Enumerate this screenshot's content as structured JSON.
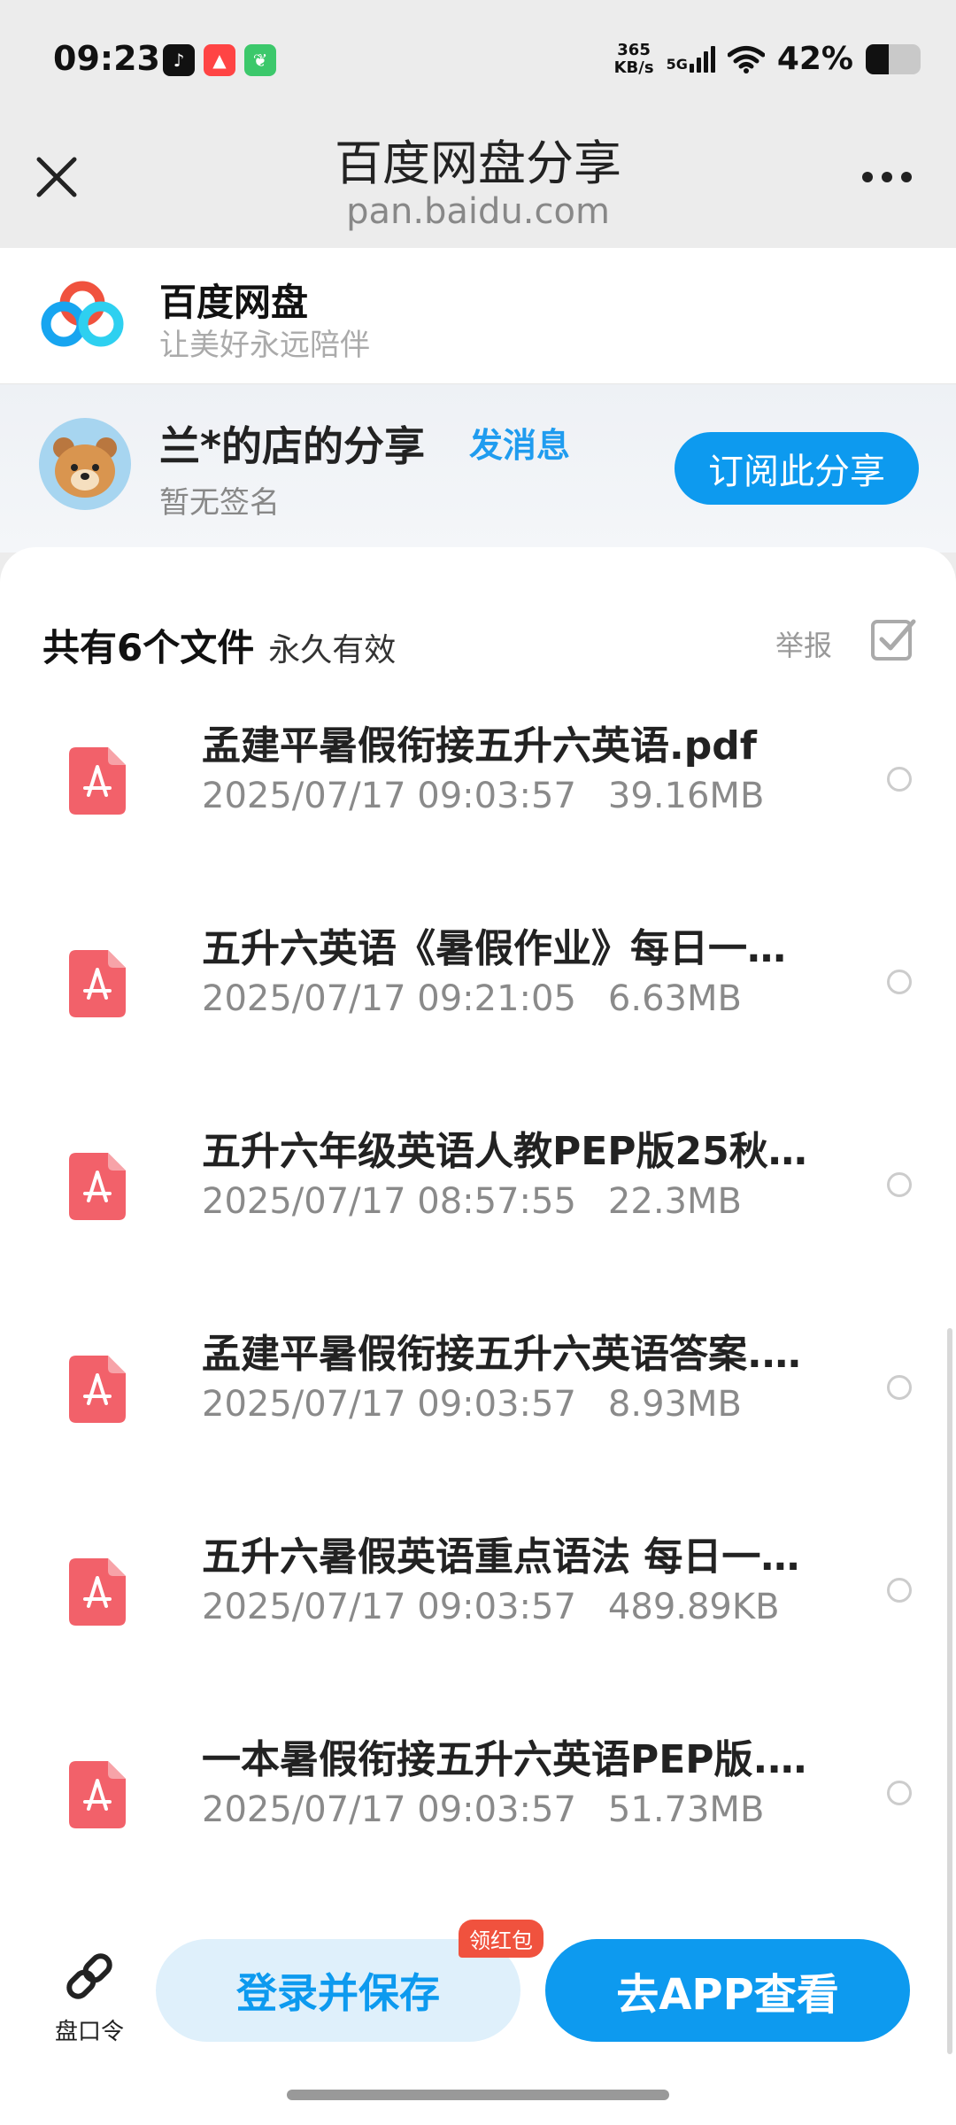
{
  "status_bar": {
    "time": "09:23",
    "net_speed_value": "365",
    "net_speed_unit": "KB/s",
    "network": "5G",
    "battery": "42%",
    "battery_level": 0.42
  },
  "title_bar": {
    "title": "百度网盘分享",
    "subtitle": "pan.baidu.com"
  },
  "brand": {
    "name": "百度网盘",
    "slogan": "让美好永远陪伴"
  },
  "sharer": {
    "name": "兰*的店的分享",
    "send_message": "发消息",
    "signature": "暂无签名",
    "subscribe": "订阅此分享"
  },
  "list_header": {
    "count": "共有6个文件",
    "validity": "永久有效",
    "report": "举报"
  },
  "files": [
    {
      "name": "孟建平暑假衔接五升六英语.pdf",
      "date": "2025/07/17 09:03:57",
      "size": "39.16MB"
    },
    {
      "name": "五升六英语《暑假作业》每日一…",
      "date": "2025/07/17 09:21:05",
      "size": "6.63MB"
    },
    {
      "name": "五升六年级英语人教PEP版25秋…",
      "date": "2025/07/17 08:57:55",
      "size": "22.3MB"
    },
    {
      "name": "孟建平暑假衔接五升六英语答案.…",
      "date": "2025/07/17 09:03:57",
      "size": "8.93MB"
    },
    {
      "name": "五升六暑假英语重点语法 每日一…",
      "date": "2025/07/17 09:03:57",
      "size": "489.89KB"
    },
    {
      "name": "一本暑假衔接五升六英语PEP版.pdf",
      "date": "2025/07/17 09:03:57",
      "size": "51.73MB"
    }
  ],
  "bottom_bar": {
    "link_code": "盘口令",
    "login_save": "登录并保存",
    "red_badge": "领红包",
    "go_app": "去APP查看"
  },
  "colors": {
    "accent": "#0d9aef",
    "pdf_red": "#f2616a",
    "badge_red": "#f0523e"
  }
}
